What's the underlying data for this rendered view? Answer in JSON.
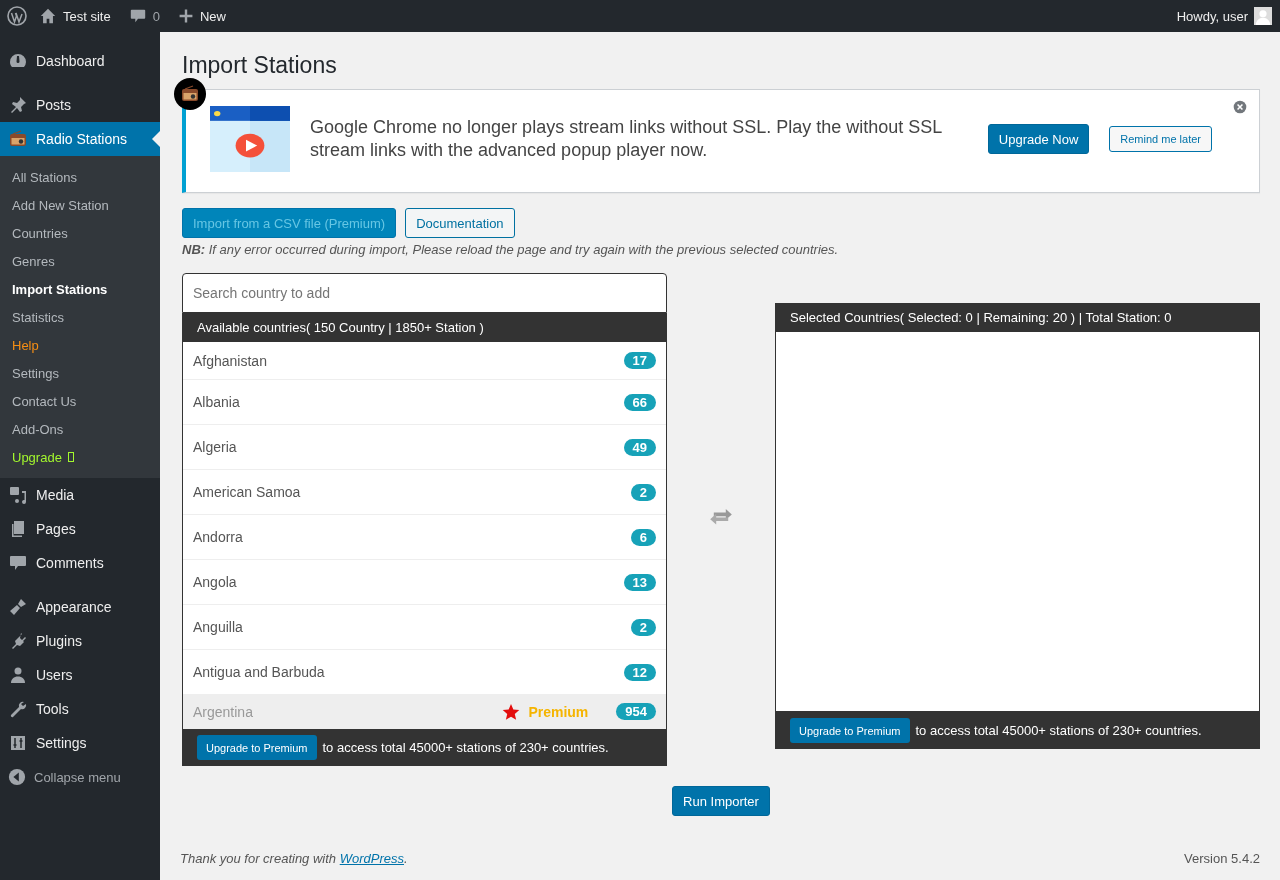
{
  "admin_bar": {
    "site": "Test site",
    "comments": "0",
    "new": "New",
    "greeting": "Howdy, user"
  },
  "sidebar": {
    "items": [
      {
        "label": "Dashboard",
        "kind": "dashboard",
        "selected": false
      },
      {
        "label": "Posts",
        "kind": "pin",
        "selected": false
      },
      {
        "label": "Radio Stations",
        "kind": "radio",
        "selected": true,
        "children": [
          {
            "label": "All Stations",
            "kind": "link",
            "selected": false
          },
          {
            "label": "Add New Station",
            "kind": "link",
            "selected": false
          },
          {
            "label": "Countries",
            "kind": "link",
            "selected": false
          },
          {
            "label": "Genres",
            "kind": "link",
            "selected": false
          },
          {
            "label": "Import Stations",
            "kind": "link",
            "selected": true
          },
          {
            "label": "Statistics",
            "kind": "link",
            "selected": false
          },
          {
            "label": "Help",
            "kind": "help",
            "selected": false
          },
          {
            "label": "Settings",
            "kind": "link",
            "selected": false
          },
          {
            "label": "Contact Us",
            "kind": "link",
            "selected": false
          },
          {
            "label": "Add-Ons",
            "kind": "link",
            "selected": false
          },
          {
            "label": "Upgrade",
            "kind": "upgrade",
            "selected": false
          }
        ]
      },
      {
        "label": "Media",
        "kind": "media",
        "selected": false
      },
      {
        "label": "Pages",
        "kind": "pages",
        "selected": false
      },
      {
        "label": "Comments",
        "kind": "comment",
        "selected": false
      },
      {
        "label": "Appearance",
        "kind": "brush",
        "selected": false
      },
      {
        "label": "Plugins",
        "kind": "plug",
        "selected": false
      },
      {
        "label": "Users",
        "kind": "user",
        "selected": false
      },
      {
        "label": "Tools",
        "kind": "wrench",
        "selected": false
      },
      {
        "label": "Settings",
        "kind": "sliders",
        "selected": false
      }
    ],
    "collapse": "Collapse menu"
  },
  "page_title": "Import Stations",
  "notice": {
    "text": "Google Chrome no longer plays stream links without SSL. Play the without SSL stream links with the advanced popup player now.",
    "primary": "Upgrade Now",
    "secondary": "Remind me later"
  },
  "buttons": [
    {
      "label": "Import from a CSV file (Premium)",
      "kind": "primary"
    },
    {
      "label": "Documentation",
      "kind": "secondary"
    }
  ],
  "note": "**NB:** If any error occurred during import, Please reload the page and try again with the previous selected countries.",
  "available": {
    "placeholder": "Search country to add",
    "header": "Available countries( 150 Country | 1850+ Station )",
    "rows": [
      {
        "name": "Afghanistan",
        "count": "17",
        "premium": false
      },
      {
        "name": "Albania",
        "count": "66",
        "premium": false
      },
      {
        "name": "Algeria",
        "count": "49",
        "premium": false
      },
      {
        "name": "American Samoa",
        "count": "2",
        "premium": false
      },
      {
        "name": "Andorra",
        "count": "6",
        "premium": false
      },
      {
        "name": "Angola",
        "count": "13",
        "premium": false
      },
      {
        "name": "Anguilla",
        "count": "2",
        "premium": false
      },
      {
        "name": "Antigua and Barbuda",
        "count": "12",
        "premium": false
      },
      {
        "name": "Argentina",
        "count": "954",
        "premium": true,
        "premium_label": "Premium"
      }
    ],
    "footer_button": "Upgrade to Premium",
    "footer_text": "to access total 45000+ stations of 230+ countries."
  },
  "selected": {
    "header": "Selected Countries( Selected: 0 | Remaining: 20 ) | Total Station: 0",
    "footer_button": "Upgrade to Premium",
    "footer_text": "to access total 45000+ stations of 230+ countries."
  },
  "run_button": "Run Importer",
  "footer": {
    "thanks": "*Thank you for creating with* ",
    "link": "WordPress",
    "after": ".",
    "version": "Version 5.4.2"
  }
}
